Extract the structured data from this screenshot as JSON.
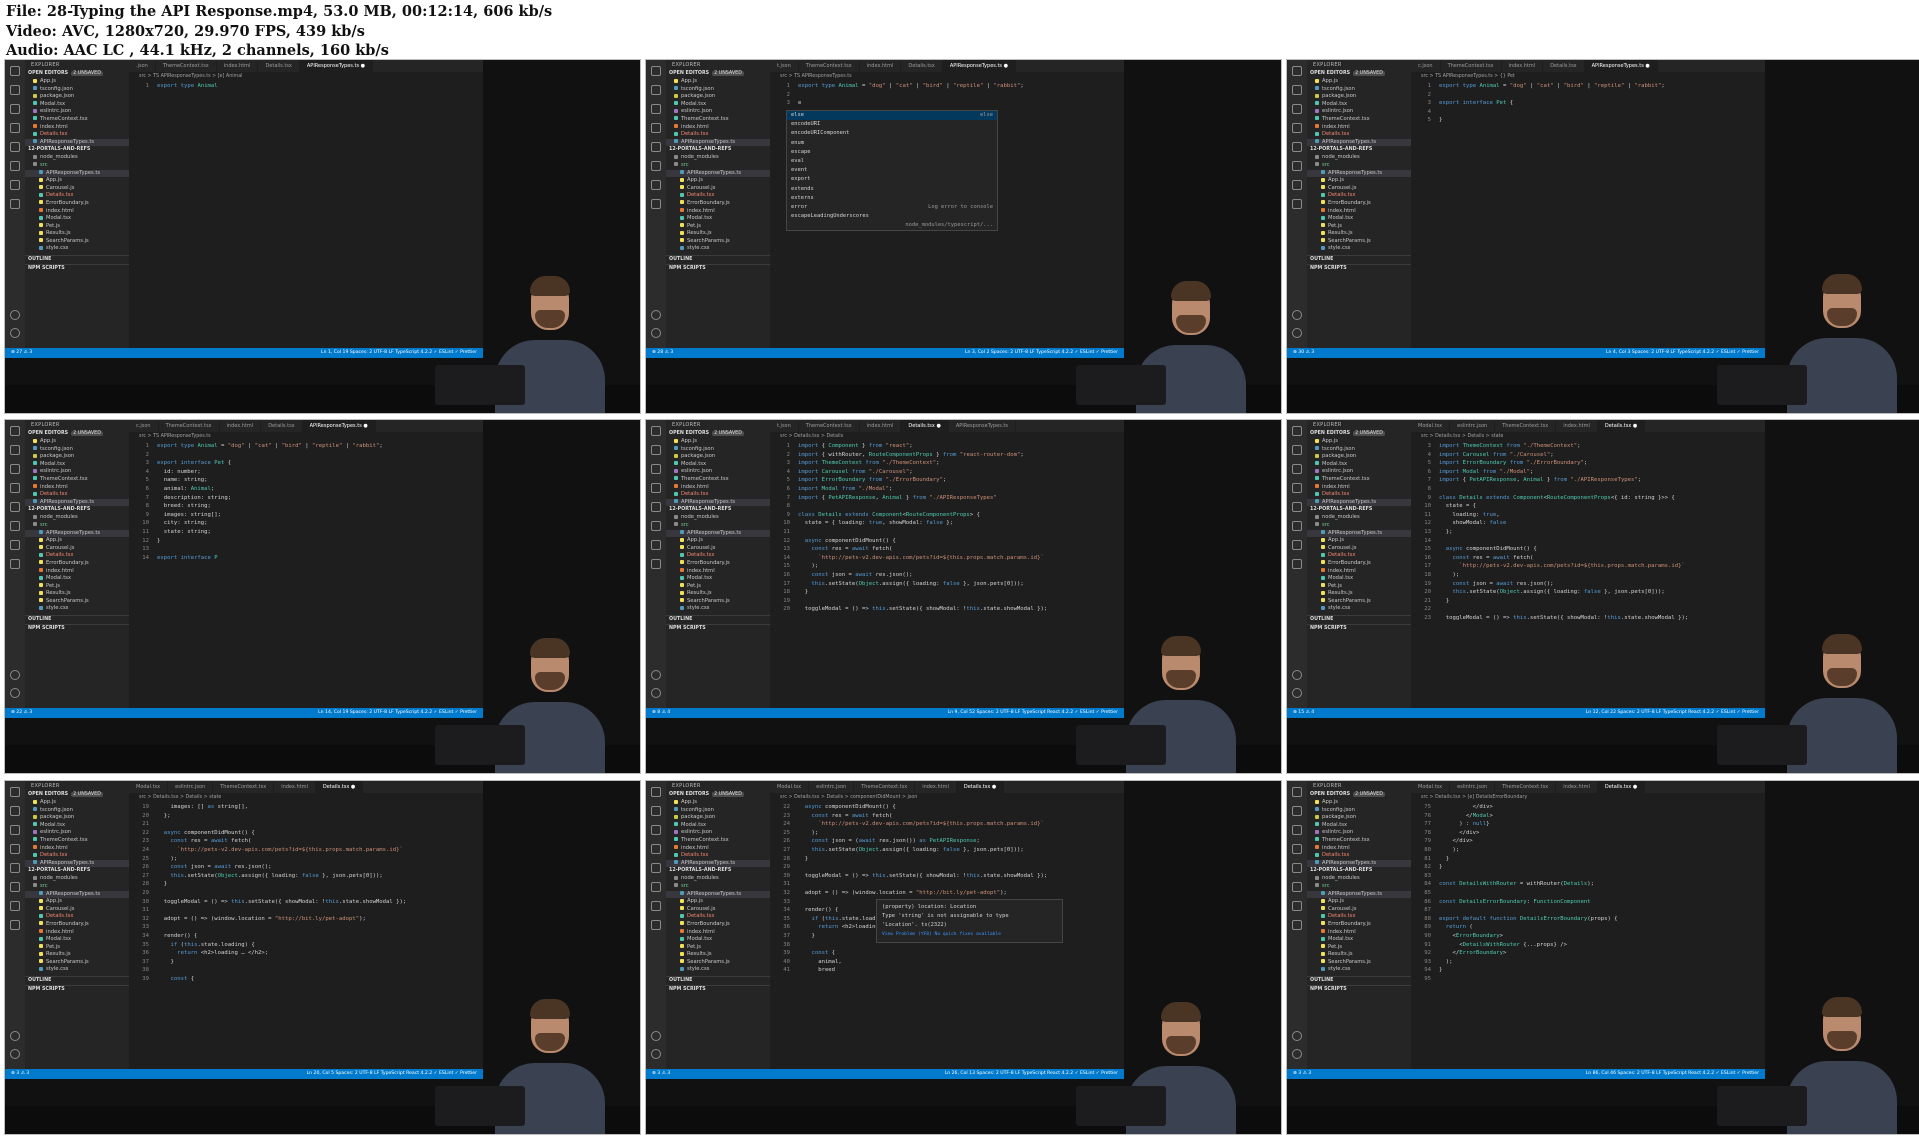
{
  "header": {
    "file_line": "File: 28-Typing the API Response.mp4, 53.0 MB, 00:12:14, 606 kb/s",
    "video_line": "Video: AVC, 1280x720, 29.970 FPS, 439 kb/s",
    "audio_line": "Audio: AAC LC , 44.1 kHz, 2 channels, 160 kb/s"
  },
  "colors": {
    "statusbar": "#007acc",
    "editor_bg": "#1e1e1e",
    "sidebar_bg": "#252526",
    "keyword": "#569cd6",
    "string": "#ce9178",
    "type": "#4ec9b0"
  },
  "sidebar_common": {
    "explorer_title": "EXPLORER",
    "open_editors_label": "OPEN EDITORS",
    "project_label": "12-PORTALS-AND-REFS",
    "outline_label": "OUTLINE",
    "npm_scripts_label": "NPM SCRIPTS",
    "files": [
      "App.js",
      "tsconfig.json",
      "package.json",
      "Modal.tsx",
      "eslintrc.json",
      "ThemeContext.tsx",
      "index.html",
      "Details.tsx",
      "APIResponseTypes.ts",
      "node_modules",
      "src",
      "APIResponseTypes.ts",
      "App.js",
      "Carousel.js",
      "Details.tsx",
      "ErrorBoundary.js",
      "index.html",
      "Modal.tsx",
      "Pet.js",
      "Results.js",
      "SearchParams.js",
      "style.css"
    ]
  },
  "frames": [
    {
      "unsaved": "2 UNSAVED",
      "tabs": [
        ".json",
        "ThemeContext.tsx",
        "index.html",
        "Details.tsx",
        "APIResponseTypes.ts"
      ],
      "active_tab": 4,
      "breadcrumb": "src > TS APIResponseTypes.ts > [e] Animal",
      "code": [
        [
          "1",
          "export type Animal"
        ]
      ],
      "status_left": "⊗ 27 ⚠ 3",
      "status_right": "Ln 1, Col 19   Spaces: 2   UTF-8   LF   TypeScript   4.2.2   ✓ ESLint   ✓ Prettier"
    },
    {
      "unsaved": "2 UNSAVED",
      "tabs": [
        "t.json",
        "ThemeContext.tsx",
        "index.html",
        "Details.tsx",
        "APIResponseTypes.ts"
      ],
      "active_tab": 4,
      "breadcrumb": "src > TS APIResponseTypes.ts",
      "code": [
        [
          "1",
          "export type Animal = \"dog\" | \"cat\" | \"bird\" | \"reptile\" | \"rabbit\";"
        ],
        [
          "2",
          ""
        ],
        [
          "3",
          "e"
        ]
      ],
      "popup": [
        [
          "else",
          "else"
        ],
        [
          "encodeURI",
          ""
        ],
        [
          "encodeURIComponent",
          ""
        ],
        [
          "enum",
          ""
        ],
        [
          "escape",
          ""
        ],
        [
          "eval",
          ""
        ],
        [
          "event",
          ""
        ],
        [
          "export",
          ""
        ],
        [
          "extends",
          ""
        ],
        [
          "externs",
          ""
        ],
        [
          "error",
          "Log error to console"
        ],
        [
          "escapeLeadingUnderscores",
          "node_modules/typescript/..."
        ]
      ],
      "status_left": "⊗ 28 ⚠ 3",
      "status_right": "Ln 3, Col 2   Spaces: 2   UTF-8   LF   TypeScript   4.2.2   ✓ ESLint   ✓ Prettier"
    },
    {
      "unsaved": "2 UNSAVED",
      "tabs": [
        "c.json",
        "ThemeContext.tsx",
        "index.html",
        "Details.tsx",
        "APIResponseTypes.ts"
      ],
      "active_tab": 4,
      "breadcrumb": "src > TS APIResponseTypes.ts > {} Pet",
      "code": [
        [
          "1",
          "export type Animal = \"dog\" | \"cat\" | \"bird\" | \"reptile\" | \"rabbit\";"
        ],
        [
          "2",
          ""
        ],
        [
          "3",
          "export interface Pet {"
        ],
        [
          "4",
          ""
        ],
        [
          "5",
          "}"
        ]
      ],
      "status_left": "⊗ 30 ⚠ 3",
      "status_right": "Ln 4, Col 3   Spaces: 2   UTF-8   LF   TypeScript   4.2.2   ✓ ESLint   ✓ Prettier"
    },
    {
      "unsaved": "2 UNSAVED",
      "tabs": [
        "c.json",
        "ThemeContext.tsx",
        "index.html",
        "Details.tsx",
        "APIResponseTypes.ts"
      ],
      "active_tab": 4,
      "breadcrumb": "src > TS APIResponseTypes.ts",
      "code": [
        [
          "1",
          "export type Animal = \"dog\" | \"cat\" | \"bird\" | \"reptile\" | \"rabbit\";"
        ],
        [
          "2",
          ""
        ],
        [
          "3",
          "export interface Pet {"
        ],
        [
          "4",
          "  id: number;"
        ],
        [
          "5",
          "  name: string;"
        ],
        [
          "6",
          "  animal: Animal;"
        ],
        [
          "7",
          "  description: string;"
        ],
        [
          "8",
          "  breed: string;"
        ],
        [
          "9",
          "  images: string[];"
        ],
        [
          "10",
          "  city: string;"
        ],
        [
          "11",
          "  state: string;"
        ],
        [
          "12",
          "}"
        ],
        [
          "13",
          ""
        ],
        [
          "14",
          "export interface P"
        ]
      ],
      "status_left": "⊗ 22 ⚠ 3",
      "status_right": "Ln 14, Col 19   Spaces: 2   UTF-8   LF   TypeScript   4.2.2   ✓ ESLint   ✓ Prettier"
    },
    {
      "unsaved": "2 UNSAVED",
      "tabs": [
        "t.json",
        "ThemeContext.tsx",
        "index.html",
        "Details.tsx",
        "APIResponseTypes.ts"
      ],
      "active_tab": 3,
      "breadcrumb": "src > Details.tsx > Details",
      "code": [
        [
          "1",
          "import { Component } from \"react\";"
        ],
        [
          "2",
          "import { withRouter, RouteComponentProps } from \"react-router-dom\";"
        ],
        [
          "3",
          "import ThemeContext from \"./ThemeContext\";"
        ],
        [
          "4",
          "import Carousel from \"./Carousel\";"
        ],
        [
          "5",
          "import ErrorBoundary from \"./ErrorBoundary\";"
        ],
        [
          "6",
          "import Modal from \"./Modal\";"
        ],
        [
          "7",
          "import { PetAPIResponse, Animal } from \"./APIResponseTypes\""
        ],
        [
          "8",
          ""
        ],
        [
          "9",
          "class Details extends Component<RouteComponentProps> {"
        ],
        [
          "10",
          "  state = { loading: true, showModal: false };"
        ],
        [
          "11",
          ""
        ],
        [
          "12",
          "  async componentDidMount() {"
        ],
        [
          "13",
          "    const res = await fetch("
        ],
        [
          "14",
          "      `http://pets-v2.dev-apis.com/pets?id=${this.props.match.params.id}`"
        ],
        [
          "15",
          "    );"
        ],
        [
          "16",
          "    const json = await res.json();"
        ],
        [
          "17",
          "    this.setState(Object.assign({ loading: false }, json.pets[0]));"
        ],
        [
          "18",
          "  }"
        ],
        [
          "19",
          ""
        ],
        [
          "20",
          "  toggleModal = () => this.setState({ showModal: !this.state.showModal });"
        ]
      ],
      "status_left": "⊗ 8 ⚠ 4",
      "status_right": "Ln 9, Col 52   Spaces: 2   UTF-8   LF   TypeScript React   4.2.2   ✓ ESLint   ✓ Prettier"
    },
    {
      "unsaved": "2 UNSAVED",
      "tabs": [
        "Modal.tsx",
        "eslintrc.json",
        "ThemeContext.tsx",
        "index.html",
        "Details.tsx"
      ],
      "active_tab": 4,
      "breadcrumb": "src > Details.tsx > Details > state",
      "code": [
        [
          "3",
          "import ThemeContext from \"./ThemeContext\";"
        ],
        [
          "4",
          "import Carousel from \"./Carousel\";"
        ],
        [
          "5",
          "import ErrorBoundary from \"./ErrorBoundary\";"
        ],
        [
          "6",
          "import Modal from \"./Modal\";"
        ],
        [
          "7",
          "import { PetAPIResponse, Animal } from \"./APIResponseTypes\";"
        ],
        [
          "8",
          ""
        ],
        [
          "9",
          "class Details extends Component<RouteComponentProps<{ id: string }>> {"
        ],
        [
          "10",
          "  state = {"
        ],
        [
          "11",
          "    loading: true,"
        ],
        [
          "12",
          "    showModal: false"
        ],
        [
          "13",
          "  };"
        ],
        [
          "14",
          ""
        ],
        [
          "15",
          "  async componentDidMount() {"
        ],
        [
          "16",
          "    const res = await fetch("
        ],
        [
          "17",
          "      `http://pets-v2.dev-apis.com/pets?id=${this.props.match.params.id}`"
        ],
        [
          "18",
          "    );"
        ],
        [
          "19",
          "    const json = await res.json();"
        ],
        [
          "20",
          "    this.setState(Object.assign({ loading: false }, json.pets[0]));"
        ],
        [
          "21",
          "  }"
        ],
        [
          "22",
          ""
        ],
        [
          "23",
          "  toggleModal = () => this.setState({ showModal: !this.state.showModal });"
        ]
      ],
      "status_left": "⊗ 15 ⚠ 4",
      "status_right": "Ln 12, Col 22   Spaces: 2   UTF-8   LF   TypeScript React   4.2.2   ✓ ESLint   ✓ Prettier"
    },
    {
      "unsaved": "2 UNSAVED",
      "tabs": [
        "Modal.tsx",
        "eslintrc.json",
        "ThemeContext.tsx",
        "index.html",
        "Details.tsx"
      ],
      "active_tab": 4,
      "breadcrumb": "src > Details.tsx > Details > state",
      "code": [
        [
          "19",
          "    images: [] as string[],"
        ],
        [
          "20",
          "  };"
        ],
        [
          "21",
          ""
        ],
        [
          "22",
          "  async componentDidMount() {"
        ],
        [
          "23",
          "    const res = await fetch("
        ],
        [
          "24",
          "      `http://pets-v2.dev-apis.com/pets?id=${this.props.match.params.id}`"
        ],
        [
          "25",
          "    );"
        ],
        [
          "26",
          "    const json = await res.json();"
        ],
        [
          "27",
          "    this.setState(Object.assign({ loading: false }, json.pets[0]));"
        ],
        [
          "28",
          "  }"
        ],
        [
          "29",
          ""
        ],
        [
          "30",
          "  toggleModal = () => this.setState({ showModal: !this.state.showModal });"
        ],
        [
          "31",
          ""
        ],
        [
          "32",
          "  adopt = () => (window.location = \"http://bit.ly/pet-adopt\");"
        ],
        [
          "33",
          ""
        ],
        [
          "34",
          "  render() {"
        ],
        [
          "35",
          "    if (this.state.loading) {"
        ],
        [
          "36",
          "      return <h2>loading … </h2>;"
        ],
        [
          "37",
          "    }"
        ],
        [
          "38",
          ""
        ],
        [
          "39",
          "    const {"
        ]
      ],
      "status_left": "⊗ 3 ⚠ 3",
      "status_right": "Ln 20, Col 5   Spaces: 2   UTF-8   LF   TypeScript React   4.2.2   ✓ ESLint   ✓ Prettier"
    },
    {
      "unsaved": "2 UNSAVED",
      "tabs": [
        "Modal.tsx",
        "eslintrc.json",
        "ThemeContext.tsx",
        "index.html",
        "Details.tsx"
      ],
      "active_tab": 4,
      "breadcrumb": "src > Details.tsx > Details > componentDidMount > json",
      "code": [
        [
          "22",
          "  async componentDidMount() {"
        ],
        [
          "23",
          "    const res = await fetch("
        ],
        [
          "24",
          "      `http://pets-v2.dev-apis.com/pets?id=${this.props.match.params.id}`"
        ],
        [
          "25",
          "    );"
        ],
        [
          "26",
          "    const json = (await res.json()) as PetAPIResponse;"
        ],
        [
          "27",
          "    this.setState(Object.assign({ loading: false }, json.pets[0]));"
        ],
        [
          "28",
          "  }"
        ],
        [
          "29",
          ""
        ],
        [
          "30",
          "  toggleModal = () => this.setState({ showModal: !this.state.showModal });"
        ],
        [
          "31",
          ""
        ],
        [
          "32",
          "  adopt = () => (window.location = \"http://bit.ly/pet-adopt\");"
        ],
        [
          "33",
          ""
        ],
        [
          "34",
          "  render() {"
        ],
        [
          "35",
          "    if (this.state.loading) {"
        ],
        [
          "36",
          "      return <h2>loading … </h2>;"
        ],
        [
          "37",
          "    }"
        ],
        [
          "38",
          ""
        ],
        [
          "39",
          "    const {"
        ],
        [
          "40",
          "      animal,"
        ],
        [
          "41",
          "      breed"
        ]
      ],
      "hover": [
        "(property) location: Location",
        "Type 'string' is not assignable to type",
        "'Location'. ts(2322)",
        "View Problem (⌥F8)   No quick fixes available"
      ],
      "status_left": "⊗ 3 ⚠ 3",
      "status_right": "Ln 26, Col 13   Spaces: 2   UTF-8   LF   TypeScript React   4.2.2   ✓ ESLint   ✓ Prettier"
    },
    {
      "unsaved": "2 UNSAVED",
      "tabs": [
        "Modal.tsx",
        "eslintrc.json",
        "ThemeContext.tsx",
        "index.html",
        "Details.tsx"
      ],
      "active_tab": 4,
      "breadcrumb": "src > Details.tsx > [e] DetailsErrorBoundary",
      "code": [
        [
          "75",
          "          </div>"
        ],
        [
          "76",
          "        </Modal>"
        ],
        [
          "77",
          "      ) : null}"
        ],
        [
          "78",
          "      </div>"
        ],
        [
          "79",
          "    </div>"
        ],
        [
          "80",
          "    );"
        ],
        [
          "81",
          "  }"
        ],
        [
          "82",
          "}"
        ],
        [
          "83",
          ""
        ],
        [
          "84",
          "const DetailsWithRouter = withRouter(Details);"
        ],
        [
          "85",
          ""
        ],
        [
          "86",
          "const DetailsErrorBoundary: FunctionComponent"
        ],
        [
          "87",
          ""
        ],
        [
          "88",
          "export default function DetailsErrorBoundary(props) {"
        ],
        [
          "89",
          "  return ("
        ],
        [
          "90",
          "    <ErrorBoundary>"
        ],
        [
          "91",
          "      <DetailsWithRouter {...props} />"
        ],
        [
          "92",
          "    </ErrorBoundary>"
        ],
        [
          "93",
          "  );"
        ],
        [
          "94",
          "}"
        ],
        [
          "95",
          ""
        ]
      ],
      "status_left": "⊗ 3 ⚠ 3",
      "status_right": "Ln 86, Col 46   Spaces: 2   UTF-8   LF   TypeScript React   4.2.2   ✓ ESLint   ✓ Prettier"
    }
  ]
}
